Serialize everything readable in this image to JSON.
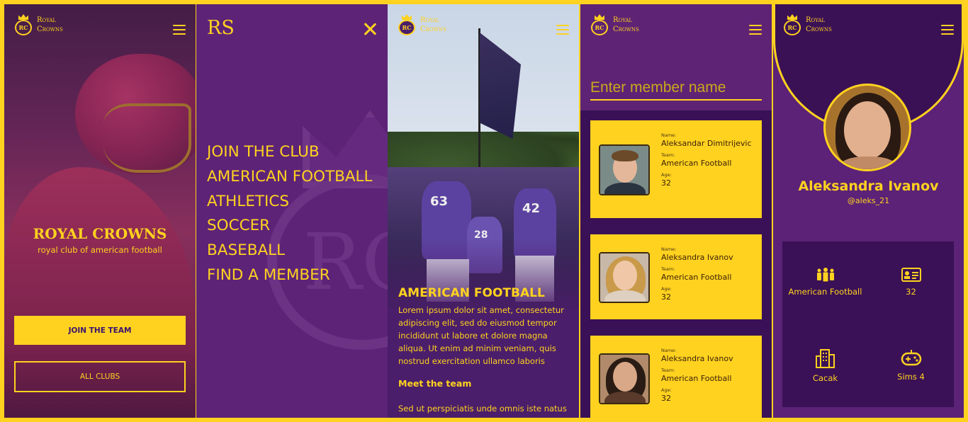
{
  "brand": {
    "logo_line1": "Royal",
    "logo_line2": "Crowns",
    "monogram": "RC",
    "short": "RS"
  },
  "colors": {
    "accent": "#ffd21f",
    "purple": "#5d2377",
    "deep_purple": "#3a1156"
  },
  "home": {
    "title": "ROYAL CROWNS",
    "subtitle": "royal club of american football",
    "primary_button": "JOIN THE TEAM",
    "secondary_button": "ALL CLUBS"
  },
  "menu": {
    "items": [
      "JOIN THE CLUB",
      "AMERICAN FOOTBALL",
      "ATHLETICS",
      "SOCCER",
      "BASEBALL",
      "FIND A MEMBER"
    ]
  },
  "article": {
    "title": "AMERICAN FOOTBALL",
    "body": "Lorem ipsum dolor sit amet, consectetur adipiscing elit, sed do eiusmod tempor incididunt ut labore et dolore magna aliqua. Ut enim ad minim veniam, quis nostrud exercitation ullamco laboris",
    "subheading": "Meet the team",
    "body2": "Sed ut perspiciatis unde omnis iste natus",
    "jersey_numbers": [
      "63",
      "42",
      "28"
    ]
  },
  "members": {
    "search_placeholder": "Enter member name",
    "labels": {
      "name": "Name:",
      "team": "Team:",
      "age": "Age:"
    },
    "list": [
      {
        "name": "Aleksandar Dimitrijevic",
        "team": "American Football",
        "age": "32"
      },
      {
        "name": "Aleksandra Ivanov",
        "team": "American Football",
        "age": "32"
      },
      {
        "name": "Aleksandra Ivanov",
        "team": "American Football",
        "age": "32"
      }
    ]
  },
  "profile": {
    "name": "Aleksandra Ivanov",
    "handle": "@aleks_21",
    "stats": [
      {
        "icon": "team-icon",
        "value": "American Football"
      },
      {
        "icon": "id-card-icon",
        "value": "32"
      },
      {
        "icon": "city-icon",
        "value": "Cacak"
      },
      {
        "icon": "gamepad-icon",
        "value": "Sims 4"
      }
    ]
  }
}
